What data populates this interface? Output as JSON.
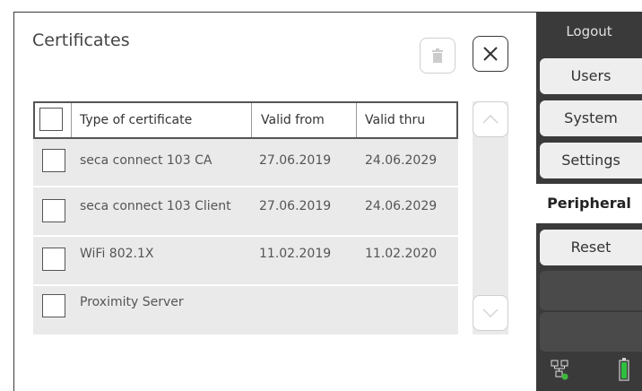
{
  "dialog": {
    "title": "Certificates"
  },
  "table": {
    "headers": [
      "Type of certificate",
      "Valid from",
      "Valid thru"
    ],
    "rows": [
      {
        "type": "seca connect 103 CA",
        "from": "27.06.2019",
        "thru": "24.06.2029"
      },
      {
        "type": "seca connect 103 Client",
        "from": "27.06.2019",
        "thru": "24.06.2029"
      },
      {
        "type": "WiFi 802.1X",
        "from": "11.02.2019",
        "thru": "11.02.2020"
      },
      {
        "type": "Proximity Server",
        "from": "",
        "thru": ""
      }
    ]
  },
  "sidebar": {
    "logout": "Logout",
    "items": [
      {
        "label": "Users"
      },
      {
        "label": "System"
      },
      {
        "label": "Settings"
      },
      {
        "label": "Peripheral"
      },
      {
        "label": "Reset"
      },
      {
        "label": ""
      },
      {
        "label": ""
      }
    ]
  },
  "icons": {
    "trash": "trash-icon",
    "close": "close-icon",
    "scroll_up": "chevron-up-icon",
    "scroll_down": "chevron-down-icon",
    "network": "network-icon",
    "battery": "battery-icon"
  },
  "colors": {
    "sidebar": "#3a3a3a",
    "status_ok": "#3db83d",
    "battery": "#2fbf3f"
  }
}
